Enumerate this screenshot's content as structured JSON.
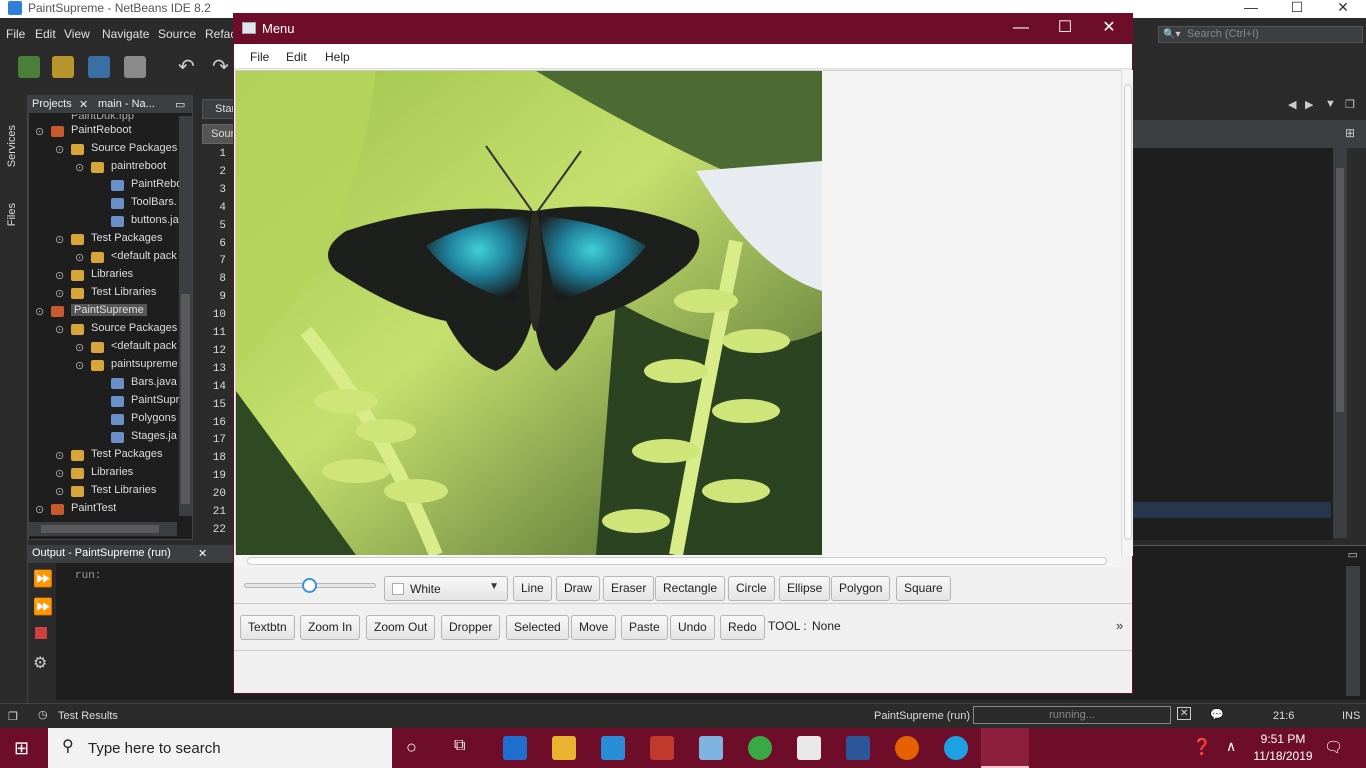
{
  "ide": {
    "title": "PaintSupreme - NetBeans IDE 8.2",
    "menus": [
      "File",
      "Edit",
      "View",
      "Navigate",
      "Source",
      "Refac"
    ],
    "search_placeholder": "Search (Ctrl+I)",
    "side_tabs": [
      "Services",
      "Files"
    ],
    "project_tabs": {
      "projects": "Projects",
      "navigator": "main - Na..."
    },
    "tree": [
      {
        "label": "PaintReboot",
        "depth": 0
      },
      {
        "label": "Source Packages",
        "depth": 1
      },
      {
        "label": "paintreboot",
        "depth": 2
      },
      {
        "label": "PaintRebo",
        "depth": 3
      },
      {
        "label": "ToolBars.",
        "depth": 3
      },
      {
        "label": "buttons.ja",
        "depth": 3
      },
      {
        "label": "Test Packages",
        "depth": 1
      },
      {
        "label": "<default pack",
        "depth": 2
      },
      {
        "label": "Libraries",
        "depth": 1
      },
      {
        "label": "Test Libraries",
        "depth": 1
      },
      {
        "label": "PaintSupreme",
        "depth": 0,
        "selected": true
      },
      {
        "label": "Source Packages",
        "depth": 1
      },
      {
        "label": "<default pack",
        "depth": 2
      },
      {
        "label": "paintsupreme",
        "depth": 2
      },
      {
        "label": "Bars.java",
        "depth": 3
      },
      {
        "label": "PaintSupr",
        "depth": 3
      },
      {
        "label": "Polygons",
        "depth": 3
      },
      {
        "label": "Stages.ja",
        "depth": 3
      },
      {
        "label": "Test Packages",
        "depth": 1
      },
      {
        "label": "Libraries",
        "depth": 1
      },
      {
        "label": "Test Libraries",
        "depth": 1
      },
      {
        "label": "PaintTest",
        "depth": 0
      }
    ],
    "tree_partial_top": "PaintDuk.fpp",
    "editor_tabs": [
      "Star",
      "Sour"
    ],
    "line_numbers": [
      "1",
      "2",
      "3",
      "4",
      "5",
      "6",
      "7",
      "8",
      "9",
      "10",
      "11",
      "12",
      "13",
      "14",
      "15",
      "16",
      "17",
      "18",
      "19",
      "20",
      "21",
      "22"
    ],
    "output_title": "Output - PaintSupreme (run)",
    "output_text": "run:",
    "status": {
      "test_results": "Test Results",
      "run_label": "PaintSupreme (run)",
      "progress_text": "running...",
      "position": "21:6",
      "mode": "INS"
    }
  },
  "app": {
    "title": "Menu",
    "menu": [
      "File",
      "Edit",
      "Help"
    ],
    "color_picker": "White",
    "row1_buttons": [
      "Line",
      "Draw",
      "Eraser",
      "Rectangle",
      "Circle",
      "Ellipse",
      "Polygon",
      "Square"
    ],
    "row2_buttons": [
      "Textbtn",
      "Zoom In",
      "Zoom Out",
      "Dropper",
      "Selected",
      "Move",
      "Paste",
      "Undo",
      "Redo"
    ],
    "tool_label": "TOOL :",
    "tool_value": "None",
    "overflow": "»",
    "slider_value": 0.5
  },
  "taskbar": {
    "search_placeholder": "Type here to search",
    "time": "9:51 PM",
    "date": "11/18/2019"
  },
  "colors": {
    "accent": "#6e0d2a",
    "ide_bg": "#2b2b2b",
    "slider": "#3b93d8"
  }
}
